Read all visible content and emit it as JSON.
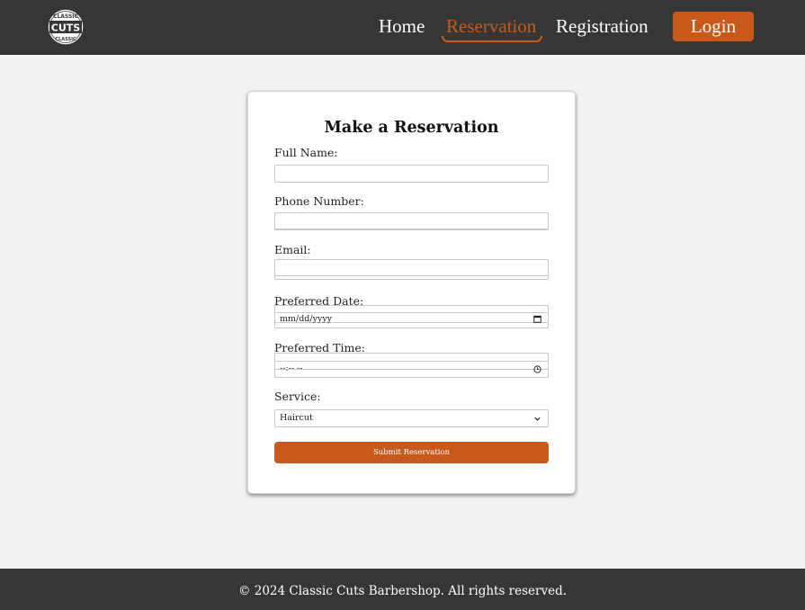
{
  "brand": {
    "logo_text_top": "CLASSIC",
    "logo_text_main": "CUTS",
    "logo_text_bottom": "CLASSIC",
    "accent_color": "#c9591a",
    "nav_bg": "#363636"
  },
  "nav": {
    "items": [
      {
        "label": "Home",
        "active": false
      },
      {
        "label": "Reservation",
        "active": true
      },
      {
        "label": "Registration",
        "active": false
      }
    ],
    "login_label": "Login"
  },
  "form": {
    "title": "Make a Reservation",
    "fields": [
      {
        "label": "Full Name:",
        "type": "text",
        "value": ""
      },
      {
        "label": "Phone Number:",
        "type": "tel",
        "value": ""
      },
      {
        "label": "Email:",
        "type": "email",
        "value": ""
      },
      {
        "label": "Preferred Date:",
        "type": "date",
        "placeholder": "mm/dd/yyyy",
        "icon": "calendar-icon"
      },
      {
        "label": "Preferred Time:",
        "type": "time",
        "placeholder": "--:-- --",
        "icon": "clock-icon"
      },
      {
        "label": "Service:",
        "type": "select",
        "selected": "Haircut",
        "icon": "chevron-down-icon"
      }
    ],
    "submit_label": "Submit Reservation"
  },
  "footer": {
    "text": "© 2024 Classic Cuts Barbershop. All rights reserved."
  }
}
